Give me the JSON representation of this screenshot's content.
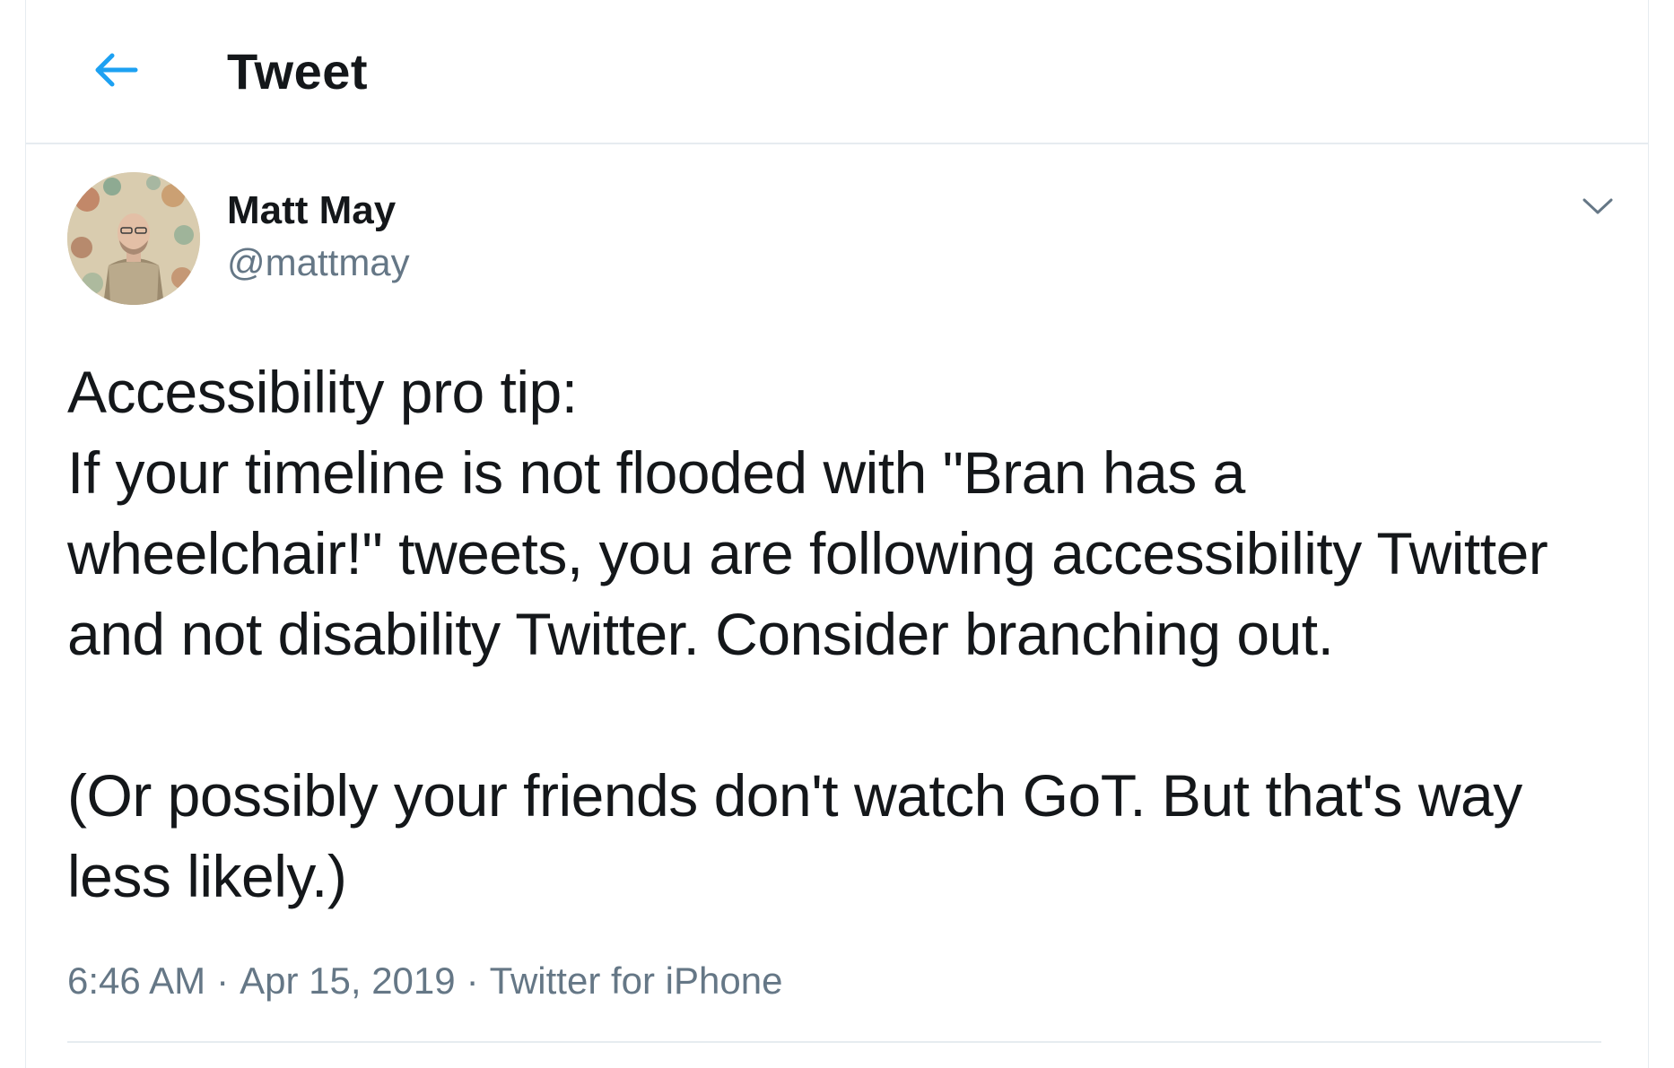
{
  "header": {
    "title": "Tweet",
    "back_icon": "arrow-left-icon"
  },
  "tweet": {
    "author": {
      "name": "Matt May",
      "handle": "@mattmay"
    },
    "text_lines": [
      "Accessibility pro tip:",
      "If your timeline is not flooded with \"Bran has a",
      "wheelchair!\" tweets, you are following accessibility Twitter",
      "and not disability Twitter. Consider branching out.",
      "",
      "(Or possibly your friends don't watch GoT. But that's way",
      "less likely.)"
    ],
    "time": "6:46 AM",
    "separator": "·",
    "date": "Apr 15, 2019",
    "source": "Twitter for iPhone",
    "menu_icon": "chevron-down-icon"
  },
  "colors": {
    "accent": "#1da1f2",
    "text_primary": "#14171a",
    "text_secondary": "#657786",
    "divider": "#e6ecf0"
  }
}
